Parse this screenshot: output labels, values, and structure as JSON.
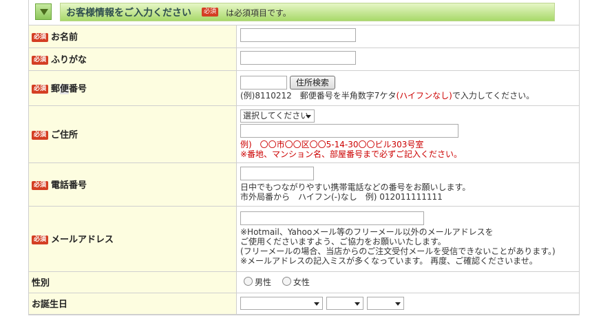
{
  "header": {
    "title": "お客様情報をご入力ください",
    "required_badge": "必須",
    "required_note": "は必須項目です。"
  },
  "fields": {
    "name": {
      "badge": "必須",
      "label": "お名前"
    },
    "furigana": {
      "badge": "必須",
      "label": "ふりがな"
    },
    "postal": {
      "badge": "必須",
      "label_a": "郵",
      "label_b": "便",
      "label_c": "番号",
      "button": "住所検索",
      "note_a": "(例)8110212　郵便番号を半角数字7ケタ",
      "note_red": "(ハイフンなし)",
      "note_b": "で入力してください。"
    },
    "address": {
      "badge": "必須",
      "label": "ご住所",
      "select_value": "選択してください",
      "example": "例)　〇〇市〇〇区〇〇5-14-30〇〇ビル303号室",
      "warning": "※番地、マンション名、部屋番号まで必ずご記入ください。"
    },
    "phone": {
      "badge": "必須",
      "label": "電話番号",
      "note1": "日中でもつながりやすい携帯電話などの番号をお願いします。",
      "note2": "市外局番から　ハイフン(-)なし　例) 012011111111"
    },
    "email": {
      "badge": "必須",
      "label": "メールアドレス",
      "note1": "※Hotmail、Yahooメール等のフリーメール以外のメールアドレスを",
      "note2": "ご使用くださいますよう、ご協力をお願いいたします。",
      "note3": "(フリーメールの場合、当店からのご注文受付メールを受信できないことがあります。)",
      "note4": "※メールアドレスの記入ミスが多くなっています。 再度、ご確認くださいませ。"
    },
    "gender": {
      "label": "性別",
      "male": "男性",
      "female": "女性"
    },
    "birthday": {
      "label": "お誕生日"
    }
  }
}
